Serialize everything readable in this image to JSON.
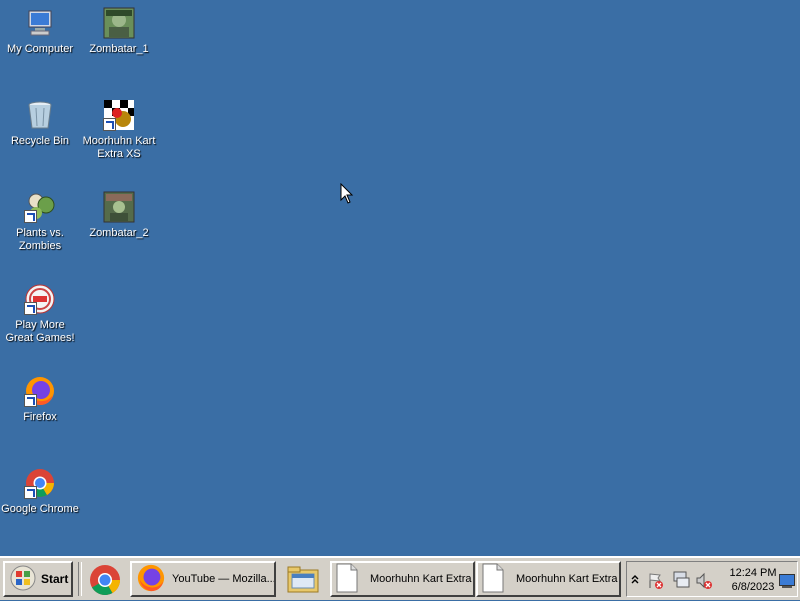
{
  "desktop": {
    "icons": [
      {
        "label": "My Computer",
        "icon": "my-computer-icon"
      },
      {
        "label": "Zombatar_1",
        "icon": "zombatar-image-icon"
      },
      {
        "label": "Recycle Bin",
        "icon": "recycle-bin-icon"
      },
      {
        "label": "Moorhuhn Kart Extra XS",
        "icon": "moorhuhn-kart-icon"
      },
      {
        "label": "Plants vs. Zombies",
        "icon": "plants-vs-zombies-icon"
      },
      {
        "label": "Zombatar_2",
        "icon": "zombatar-image-icon"
      },
      {
        "label": "Play More Great Games!",
        "icon": "popcap-games-icon"
      },
      {
        "label": "Firefox",
        "icon": "firefox-icon"
      },
      {
        "label": "Google Chrome",
        "icon": "chrome-icon"
      }
    ]
  },
  "taskbar": {
    "start_label": "Start",
    "tasks": [
      {
        "label": "YouTube — Mozilla...",
        "icon": "firefox-icon"
      },
      {
        "label": "Moorhuhn Kart Extra",
        "icon": "document-icon"
      },
      {
        "label": "Moorhuhn Kart Extra",
        "icon": "document-icon"
      }
    ],
    "clock": {
      "time": "12:24 PM",
      "date": "6/8/2023"
    }
  },
  "colors": {
    "desktop": "#3a6ea5",
    "taskbar": "#d4d0c8"
  }
}
